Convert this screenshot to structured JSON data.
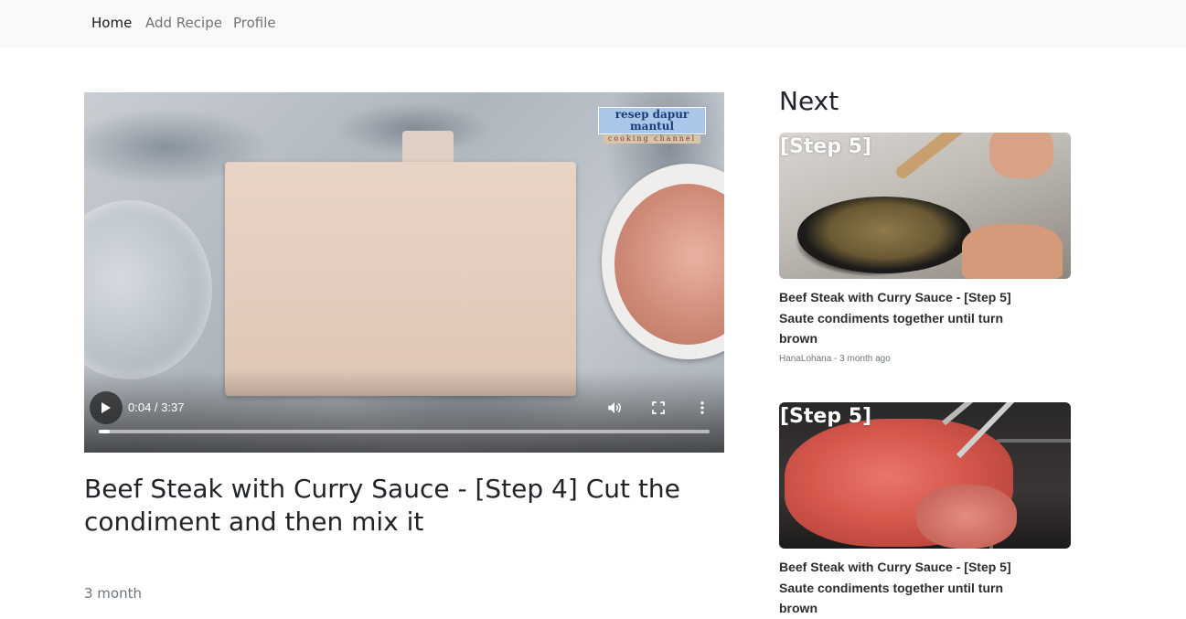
{
  "nav": {
    "items": [
      {
        "label": "Home",
        "active": true
      },
      {
        "label": "Add Recipe",
        "active": false
      },
      {
        "label": "Profile",
        "active": false
      }
    ]
  },
  "video": {
    "watermark_main": "resep dapur mantul",
    "watermark_sub": "cooking channel",
    "time": "0:04 / 3:37",
    "progress": 0.018,
    "icons": [
      "play-icon",
      "volume-icon",
      "fullscreen-icon",
      "more-vert-icon"
    ]
  },
  "main": {
    "title": "Beef Steak with Curry Sauce - [Step 4] Cut the condiment and then mix it",
    "meta": "3 month"
  },
  "next": {
    "heading": "Next",
    "cards": [
      {
        "step_label": "[Step 5]",
        "title": "Beef Steak with Curry Sauce - [Step 5] Saute condiments together until turn brown",
        "meta": "HanaLohana - 3 month ago"
      },
      {
        "step_label": "[Step 5]",
        "title": "Beef Steak with Curry Sauce - [Step 5] Saute condiments together until turn brown",
        "meta": ""
      }
    ]
  },
  "colors": {
    "navbar_bg": "#f8f9fa",
    "text_dark": "#212529",
    "text_muted": "#6c757d"
  }
}
